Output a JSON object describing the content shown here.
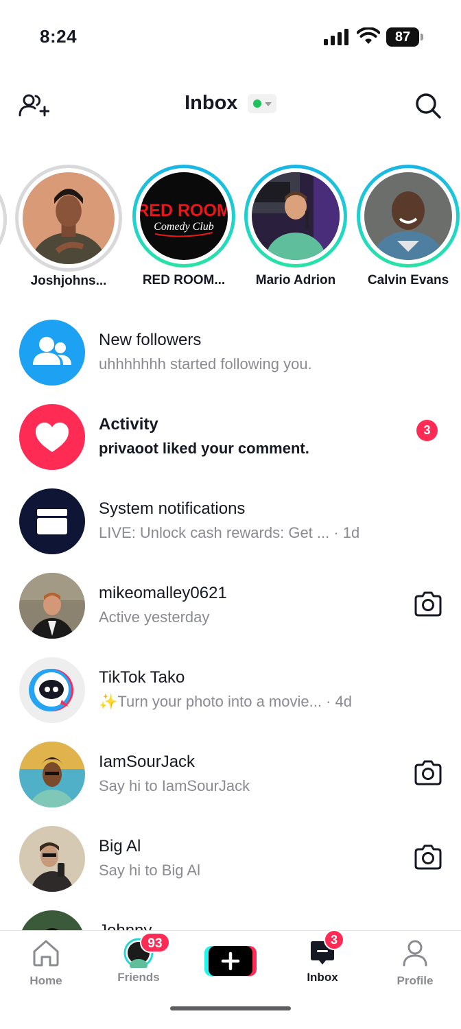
{
  "status_bar": {
    "time": "8:24",
    "battery": "87"
  },
  "header": {
    "title": "Inbox",
    "online_status_color": "#1fc15c"
  },
  "stories": [
    {
      "name": "Joshjohns...",
      "seen": true
    },
    {
      "name": "RED ROOM...",
      "seen": false
    },
    {
      "name": "Mario Adrion",
      "seen": false
    },
    {
      "name": "Calvin Evans",
      "seen": false
    }
  ],
  "red_room_logo": {
    "line1": "RED ROOM",
    "line2": "Comedy Club"
  },
  "inbox": {
    "new_followers": {
      "title": "New followers",
      "subtitle": "uhhhhhhh started following you."
    },
    "activity": {
      "title": "Activity",
      "subtitle": "privaoot liked your comment.",
      "badge": "3"
    },
    "system": {
      "title": "System notifications",
      "subtitle": "LIVE: Unlock cash rewards: Get ...",
      "time": " · 1d"
    },
    "mike": {
      "title": "mikeomalley0621",
      "subtitle": "Active yesterday"
    },
    "tako": {
      "title": "TikTok Tako",
      "subtitle": "✨Turn your photo into a movie...",
      "time": " · 4d"
    },
    "sourjack": {
      "title": "IamSourJack",
      "subtitle": "Say hi to IamSourJack"
    },
    "bigal": {
      "title": "Big Al",
      "subtitle": "Say hi to Big Al"
    },
    "johnny": {
      "title": "Johnny"
    }
  },
  "tabbar": {
    "home": "Home",
    "friends": "Friends",
    "friends_badge": "93",
    "inbox": "Inbox",
    "inbox_badge": "3",
    "profile": "Profile"
  },
  "colors": {
    "accent_red": "#fe2c55",
    "teal": "#25f4ee",
    "followers_blue": "#1da1f2",
    "activity_pink": "#fe2c55",
    "system_navy": "#0f1635"
  }
}
